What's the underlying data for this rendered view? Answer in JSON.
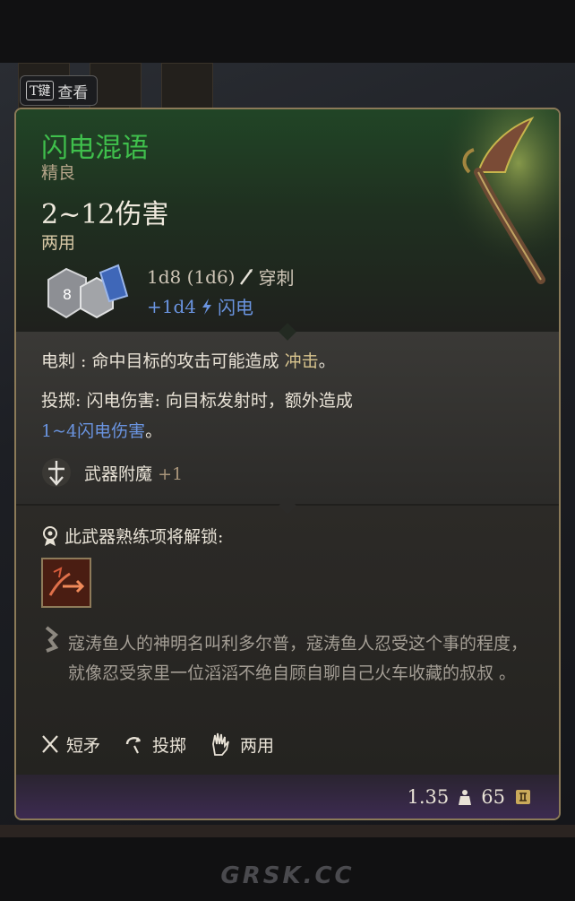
{
  "hint": {
    "key": "T键",
    "label": "查看"
  },
  "item": {
    "name": "闪电混语",
    "rarity": "精良",
    "damage": "2~12伤害",
    "handedness": "两用",
    "damage_lines": [
      {
        "text": "1d8 (1d6)",
        "type": "穿刺",
        "icon": "pierce-icon"
      },
      {
        "text": "+1d4",
        "type": "闪电",
        "icon": "lightning-icon"
      }
    ]
  },
  "abilities": {
    "electric_label": "电刺 :",
    "electric_text": "命中目标的攻击可能造成",
    "electric_effect": "冲击",
    "electric_end": "。",
    "throw_line1": "投掷:  闪电伤害: 向目标发射时，额外造成",
    "throw_value": "1~4闪电伤害",
    "throw_end": "。",
    "enchant_label": "武器附魔",
    "enchant_value": "+1"
  },
  "proficiency": {
    "title": "此武器熟练项将解锁:",
    "skill_icon": "skill-icon"
  },
  "flavor": "寇涛鱼人的神明名叫利多尔普，寇涛鱼人忍受这个事的程度，就像忍受家里一位滔滔不绝自顾自聊自己火车收藏的叔叔 。",
  "properties": [
    {
      "label": "短矛",
      "icon": "spear-icon"
    },
    {
      "label": "投掷",
      "icon": "throw-icon"
    },
    {
      "label": "两用",
      "icon": "hand-icon"
    }
  ],
  "footer": {
    "weight": "1.35",
    "price": "65"
  },
  "watermark": "GRSK.CC",
  "colors": {
    "name": "#3fbf4c",
    "lightning": "#6a94e0",
    "border": "#8b7a58",
    "footer": "#3d2b52"
  }
}
